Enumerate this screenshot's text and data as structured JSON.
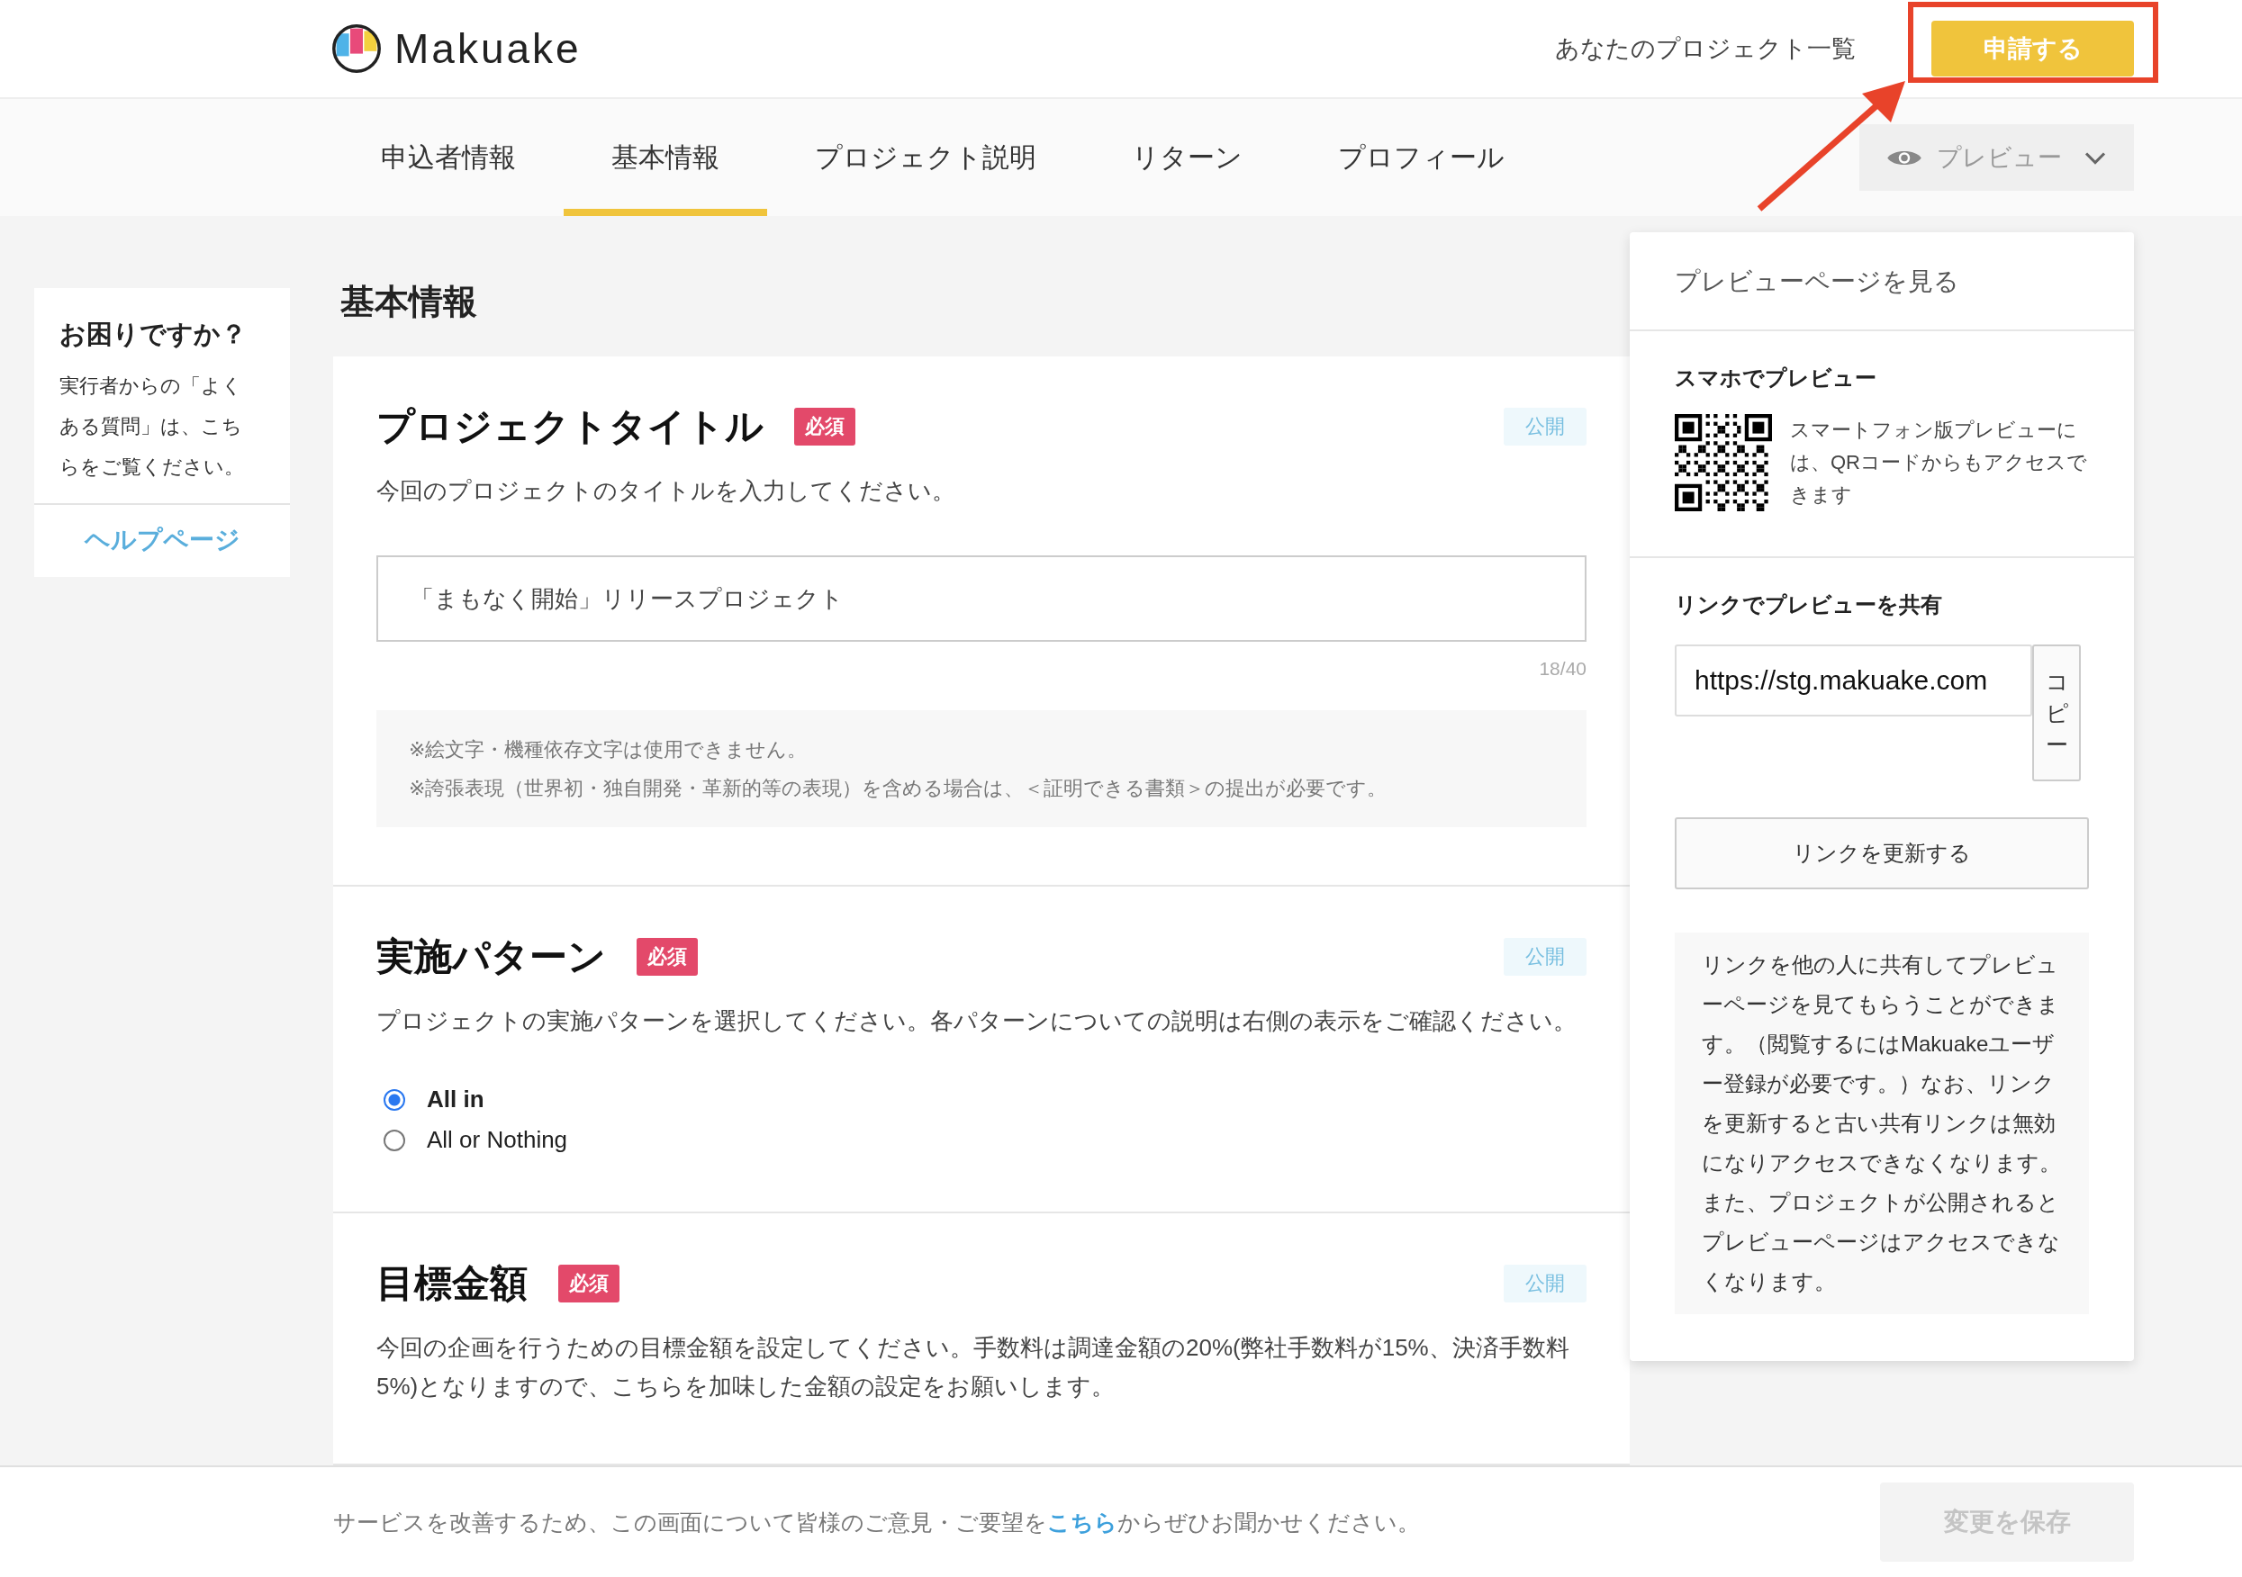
{
  "header": {
    "logo_text": "Makuake",
    "projects_link": "あなたのプロジェクト一覧",
    "apply_button": "申請する"
  },
  "tabs": [
    {
      "label": "申込者情報",
      "selected": false
    },
    {
      "label": "基本情報",
      "selected": true
    },
    {
      "label": "プロジェクト説明",
      "selected": false
    },
    {
      "label": "リターン",
      "selected": false
    },
    {
      "label": "プロフィール",
      "selected": false
    }
  ],
  "preview_button": {
    "label": "プレビュー"
  },
  "help": {
    "title": "お困りですか？",
    "text": "実行者からの「よくある質問」は、こちらをご覧ください。",
    "link": "ヘルプページ"
  },
  "page_title": "基本情報",
  "sections": [
    {
      "kind": "text_input",
      "title": "プロジェクトタイトル",
      "badge": "必須",
      "visibility": "公開",
      "description": "今回のプロジェクトのタイトルを入力してください。",
      "value": "「まもなく開始」リリースプロジェクト",
      "counter": "18/40",
      "notes": [
        "※絵文字・機種依存文字は使用できません。",
        "※誇張表現（世界初・独自開発・革新的等の表現）を含める場合は、＜証明できる書類＞の提出が必要です。"
      ]
    },
    {
      "kind": "radio",
      "title": "実施パターン",
      "badge": "必須",
      "visibility": "公開",
      "description": "プロジェクトの実施パターンを選択してください。各パターンについての説明は右側の表示をご確認ください。",
      "options": [
        {
          "label": "All in",
          "selected": true
        },
        {
          "label": "All or Nothing",
          "selected": false
        }
      ]
    },
    {
      "kind": "text",
      "title": "目標金額",
      "badge": "必須",
      "visibility": "公開",
      "description": "今回の企画を行うための目標金額を設定してください。手数料は調達金額の20%(弊社手数料が15%、決済手数料5%)となりますので、こちらを加味した金額の設定をお願いします。"
    }
  ],
  "preview_panel": {
    "view_link": "プレビューページを見る",
    "mobile_title": "スマホでプレビュー",
    "mobile_text": "スマートフォン版プレビューには、QRコードからもアクセスできます",
    "share_title": "リンクでプレビューを共有",
    "url": "https://stg.makuake.com",
    "copy_button": "コピー",
    "update_button": "リンクを更新する",
    "info": "リンクを他の人に共有してプレビューページを見てもらうことができます。（閲覧するにはMakuakeユーザー登録が必要です。）なお、リンクを更新すると古い共有リンクは無効になりアクセスできなくなります。また、プロジェクトが公開されるとプレビューページはアクセスできなくなります。"
  },
  "footer": {
    "text_before": "サービスを改善するため、この画面について皆様のご意見・ご要望を",
    "link": "こちら",
    "text_after": "からぜひお聞かせください。",
    "save_button": {
      "label": "変更を保存",
      "disabled": true
    }
  }
}
